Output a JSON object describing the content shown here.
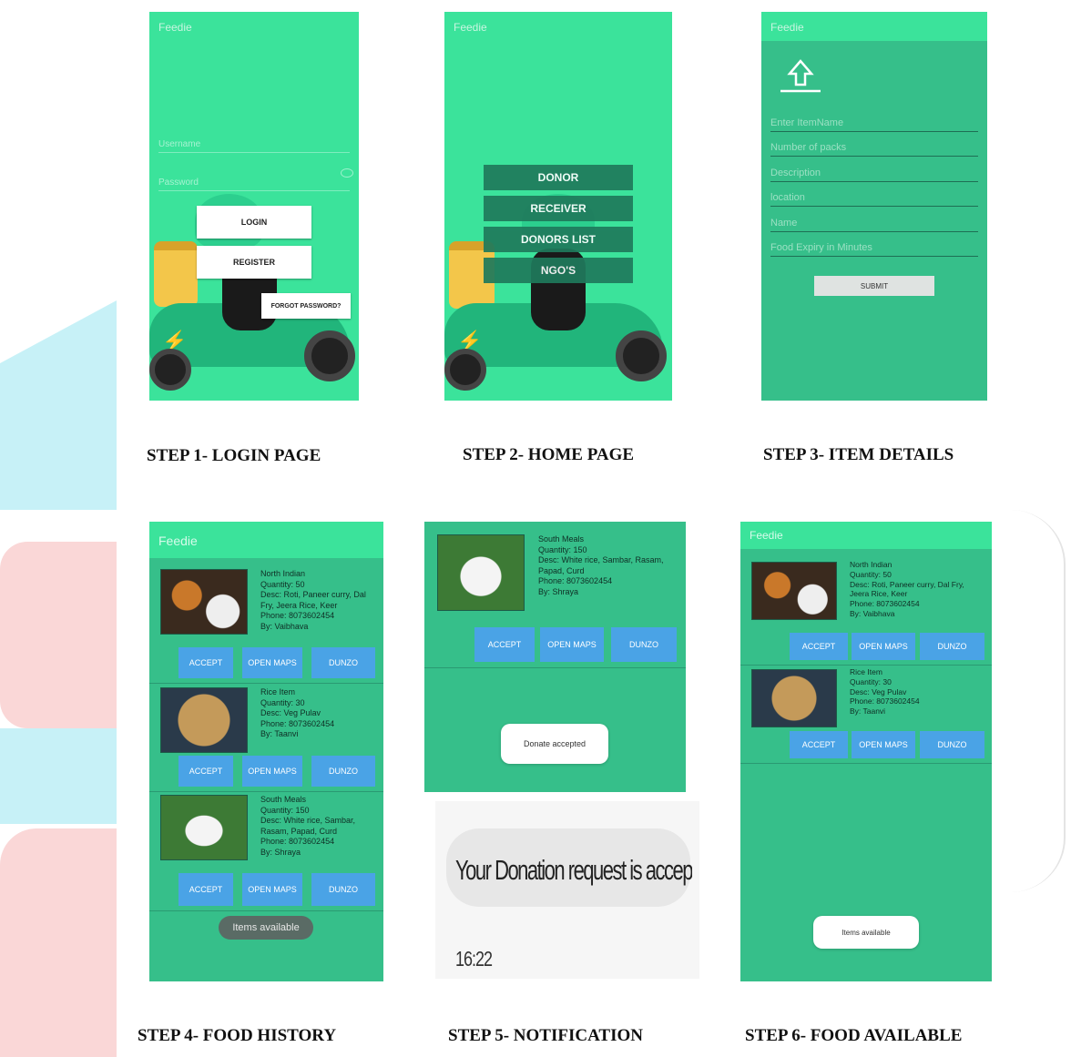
{
  "app_name": "Feedie",
  "colors": {
    "app_green": "#36bf8a",
    "bright_green": "#3be39b",
    "button_blue": "#4aa3e6",
    "dark_button": "#1f7a5c"
  },
  "screen1": {
    "title": "Feedie",
    "username_placeholder": "Username",
    "password_placeholder": "Password",
    "login_label": "LOGIN",
    "register_label": "REGISTER",
    "forgot_label": "FORGOT PASSWORD?",
    "caption": "STEP 1- LOGIN PAGE"
  },
  "screen2": {
    "title": "Feedie",
    "buttons": [
      "DONOR",
      "RECEIVER",
      "DONORS LIST",
      "NGO'S"
    ],
    "caption": "STEP 2- HOME PAGE"
  },
  "screen3": {
    "title": "Feedie",
    "upload_icon": "upload-icon",
    "fields": [
      "Enter ItemName",
      "Number of packs",
      "Description",
      "location",
      "Name",
      "Food Expiry in Minutes"
    ],
    "submit_label": "SUBMIT",
    "caption": "STEP 3- ITEM DETAILS"
  },
  "screen4": {
    "title": "Feedie",
    "items": [
      {
        "text": "North Indian\nQuantity: 50\nDesc:  Roti, Paneer curry, Dal\nFry, Jeera Rice, Keer\nPhone: 8073602454\nBy: Vaibhava"
      },
      {
        "text": "Rice Item\nQuantity: 30\nDesc:  Veg Pulav\nPhone: 8073602454\nBy: Taanvi"
      },
      {
        "text": "South Meals\nQuantity: 150\nDesc:  White rice, Sambar,\nRasam, Papad, Curd\nPhone: 8073602454\nBy: Shraya"
      }
    ],
    "accept_label": "ACCEPT",
    "maps_label": "OPEN MAPS",
    "dunzo_label": "DUNZO",
    "toast": "Items available",
    "caption": "STEP 4- FOOD HISTORY"
  },
  "screen5": {
    "item_text": "South Meals\nQuantity: 150\nDesc:  White rice, Sambar, Rasam,\nPapad, Curd\nPhone: 8073602454\nBy: Shraya",
    "accept_label": "ACCEPT",
    "maps_label": "OPEN MAPS",
    "dunzo_label": "DUNZO",
    "toast": "Donate accepted",
    "notification_text": "Your Donation request is accepted by",
    "notification_time": "16:22",
    "caption": "STEP 5- NOTIFICATION"
  },
  "screen6": {
    "title": "Feedie",
    "items": [
      {
        "text": "North Indian\nQuantity: 50\nDesc:  Roti, Paneer curry, Dal Fry,\nJeera Rice, Keer\nPhone: 8073602454\nBy: Vaibhava"
      },
      {
        "text": "Rice Item\nQuantity: 30\nDesc:  Veg Pulav\nPhone: 8073602454\nBy: Taanvi"
      }
    ],
    "accept_label": "ACCEPT",
    "maps_label": "OPEN MAPS",
    "dunzo_label": "DUNZO",
    "toast": "Items available",
    "caption": "STEP 6- FOOD AVAILABLE"
  }
}
